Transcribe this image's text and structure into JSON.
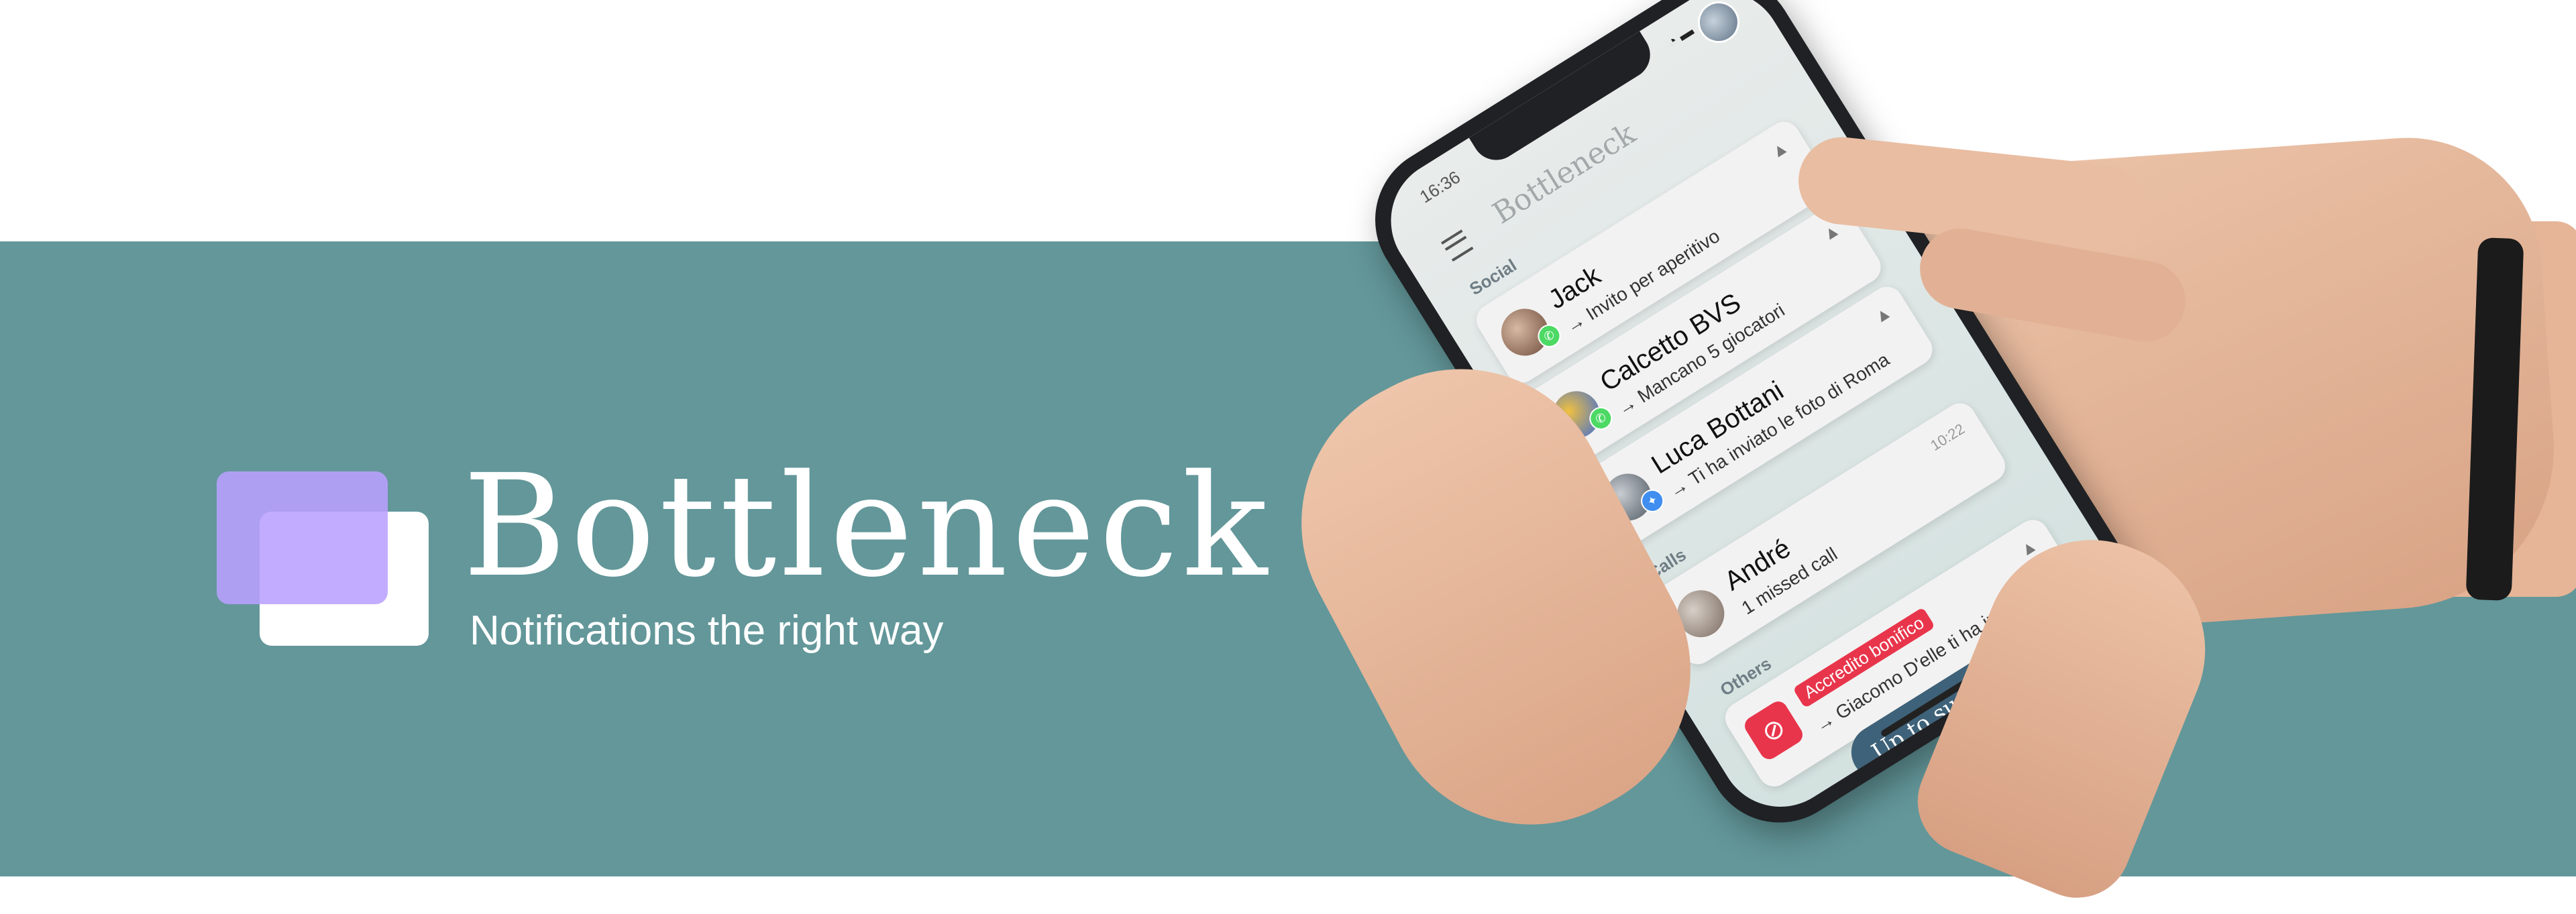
{
  "brand": {
    "title": "Bottleneck",
    "subtitle": "Notifications the right way"
  },
  "phone": {
    "time": "16:36",
    "status_icons": "◔ ▬",
    "app_title": "Bottleneck",
    "sections": {
      "social": "Social",
      "calls": "Calls",
      "others": "Others"
    },
    "notifications": [
      {
        "name": "Jack",
        "message": "→ Invito per aperitivo",
        "app_icon": "whatsapp-badge-icon"
      },
      {
        "name": "Calcetto BVS",
        "message": "→ Mancano 5 giocatori",
        "app_icon": "whatsapp-badge-icon"
      },
      {
        "name": "Luca Bottani",
        "message": "→ Ti ha inviato le foto di Roma",
        "app_icon": "messenger-badge-icon"
      },
      {
        "name": "André",
        "message": "1 missed call",
        "timestamp": "10:22"
      },
      {
        "tag": "Accredito bonifico",
        "message": "→ Giacomo D'elle ti ha inviato €150",
        "app_icon": "bank-icon"
      }
    ],
    "cta_label": "Up to surface"
  },
  "colors": {
    "band": "#63979a",
    "logo_front": "#b9a0ff",
    "cta": "#3e6279",
    "tag": "#e8354b"
  }
}
